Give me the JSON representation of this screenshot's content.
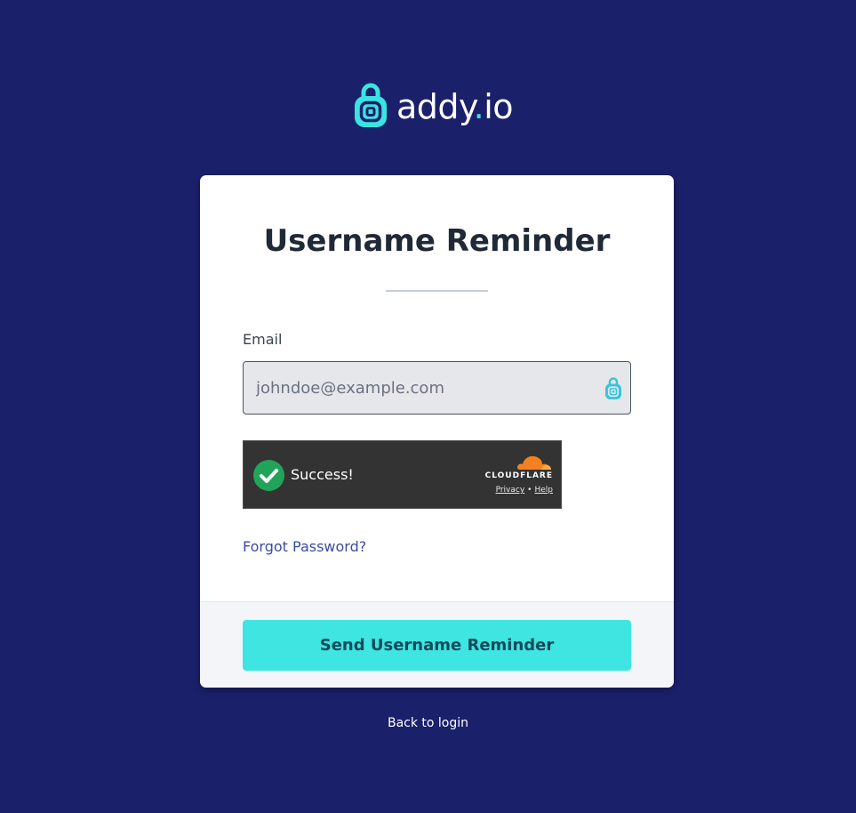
{
  "brand": {
    "name_main": "addy",
    "name_dot": ".",
    "name_tld": "io",
    "logo_icon": "addy-lock-at-icon",
    "accent_color": "#3ae4e0",
    "background_color": "#1b206b"
  },
  "card": {
    "title": "Username Reminder",
    "email": {
      "label": "Email",
      "value": "",
      "placeholder": "johndoe@example.com",
      "icon": "addy-lock-at-icon"
    },
    "captcha": {
      "status_text": "Success!",
      "status_icon": "check-circle-icon",
      "provider": "CLOUDFLARE",
      "privacy_label": "Privacy",
      "separator": "•",
      "help_label": "Help"
    },
    "forgot_password_label": "Forgot Password?",
    "submit_label": "Send Username Reminder",
    "submit_color": "#3ee5e1"
  },
  "back_to_login_label": "Back to login"
}
